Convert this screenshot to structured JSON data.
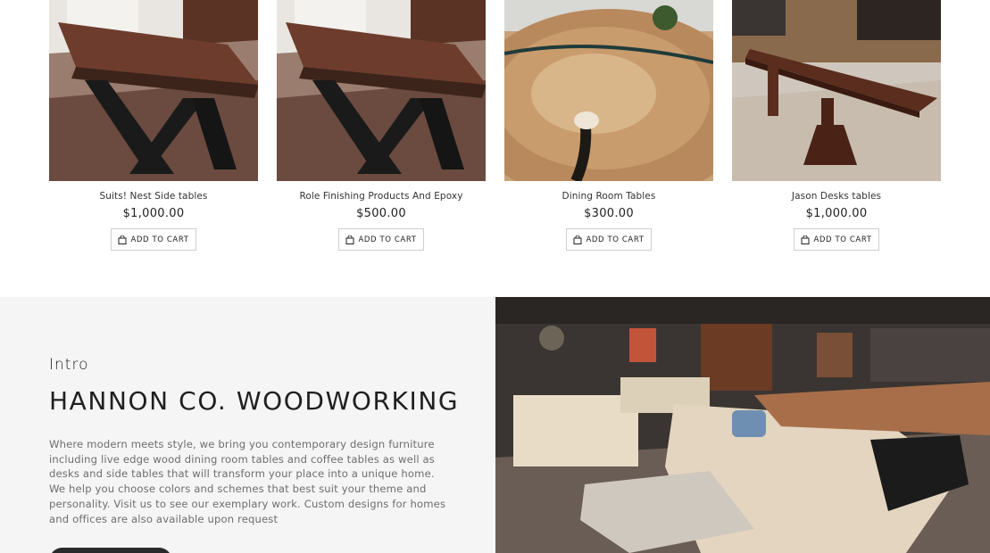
{
  "products": [
    {
      "name": "Suits! Nest Side tables",
      "price": "$1,000.00",
      "cart_label": "ADD TO CART"
    },
    {
      "name": "Role Finishing Products And Epoxy",
      "price": "$500.00",
      "cart_label": "ADD TO CART"
    },
    {
      "name": "Dining Room Tables",
      "price": "$300.00",
      "cart_label": "ADD TO CART"
    },
    {
      "name": "Jason Desks tables",
      "price": "$1,000.00",
      "cart_label": "ADD TO CART"
    }
  ],
  "intro": {
    "eyebrow": "Intro",
    "title": "HANNON CO. WOODWORKING",
    "body": "Where modern meets style, we bring you contemporary design furniture including live edge wood dining room tables and coffee tables as well as desks and side tables that will transform your place into a unique home. We help you choose colors and schemes that best suit your theme and personality. Visit us to see our exemplary work. Custom designs for homes and offices are also available upon request"
  },
  "icons": {
    "cart": "shopping-bag-icon"
  },
  "colors": {
    "section_bg": "#f5f5f5",
    "button_dark": "#2a2a2a",
    "body_text": "#6e6e6e"
  }
}
